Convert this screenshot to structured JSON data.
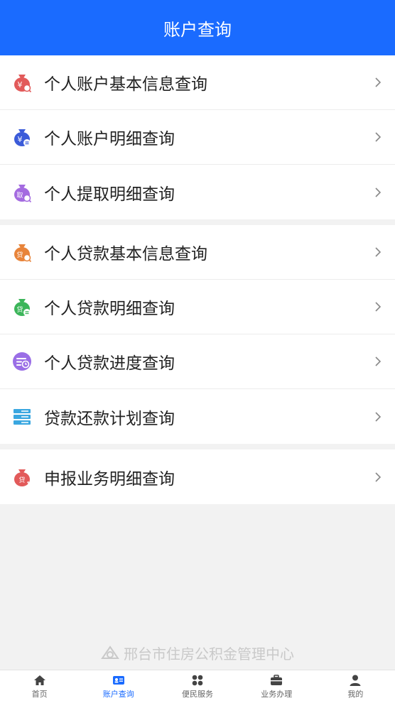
{
  "header": {
    "title": "账户查询"
  },
  "groups": [
    [
      {
        "label": "个人账户基本信息查询",
        "icon": "bag-yuan-search-icon",
        "color": "#e25a5a"
      },
      {
        "label": "个人账户明细查询",
        "icon": "bag-yuan-detail-icon",
        "color": "#3b5bd9"
      },
      {
        "label": "个人提取明细查询",
        "icon": "bag-withdraw-icon",
        "color": "#a46be0"
      }
    ],
    [
      {
        "label": "个人贷款基本信息查询",
        "icon": "bag-loan-search-icon",
        "color": "#e8843a"
      },
      {
        "label": "个人贷款明细查询",
        "icon": "bag-loan-detail-icon",
        "color": "#3cb55a"
      },
      {
        "label": "个人贷款进度查询",
        "icon": "progress-clock-icon",
        "color": "#9a6ee6"
      },
      {
        "label": "贷款还款计划查询",
        "icon": "stack-list-icon",
        "color": "#3aa7e0"
      }
    ],
    [
      {
        "label": "申报业务明细查询",
        "icon": "bag-declare-icon",
        "color": "#e25a5a"
      }
    ]
  ],
  "icon_text": {
    "yuan": "¥",
    "qu": "取",
    "dai": "贷"
  },
  "footer": {
    "org": "邢台市住房公积金管理中心"
  },
  "tabbar": [
    {
      "label": "首页",
      "icon": "home-icon"
    },
    {
      "label": "账户查询",
      "icon": "id-card-icon",
      "active": true
    },
    {
      "label": "便民服务",
      "icon": "grid-icon"
    },
    {
      "label": "业务办理",
      "icon": "briefcase-icon"
    },
    {
      "label": "我的",
      "icon": "person-icon"
    }
  ],
  "colors": {
    "accent": "#1a6bff",
    "background": "#f2f2f2"
  }
}
